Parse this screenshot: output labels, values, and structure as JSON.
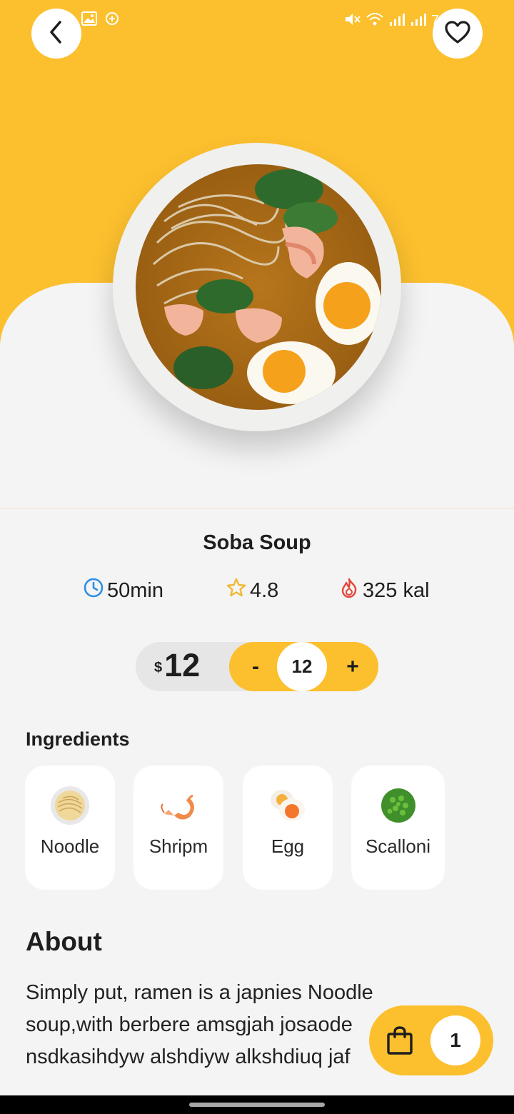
{
  "status": {
    "icons": [
      "image-icon",
      "location-icon",
      "mute-icon",
      "wifi-icon",
      "signal-icon",
      "signal-icon"
    ],
    "battery_partial": "7"
  },
  "header": {
    "back_icon": "chevron-left-icon",
    "favorite_icon": "heart-icon"
  },
  "dish": {
    "name": "Soba Soup",
    "time": "50min",
    "rating": "4.8",
    "calories": "325 kal"
  },
  "price": {
    "currency": "$",
    "value": "12"
  },
  "stepper": {
    "minus_label": "-",
    "quantity": "12",
    "plus_label": "+"
  },
  "ingredients": {
    "title": "Ingredients",
    "items": [
      {
        "label": "Noodle"
      },
      {
        "label": "Shripm"
      },
      {
        "label": "Egg"
      },
      {
        "label": "Scalloni"
      }
    ]
  },
  "about": {
    "title": "About",
    "text": "Simply put, ramen is a japnies Noodle soup,with berbere amsgjah josaode nsdkasihdyw alshdiyw alkshdiuq jaf"
  },
  "cart": {
    "count": "1"
  },
  "colors": {
    "accent": "#fcc02e",
    "background": "#f4f4f4",
    "clock": "#2d8ee5",
    "star": "#f2b731",
    "fire": "#e5453a"
  }
}
